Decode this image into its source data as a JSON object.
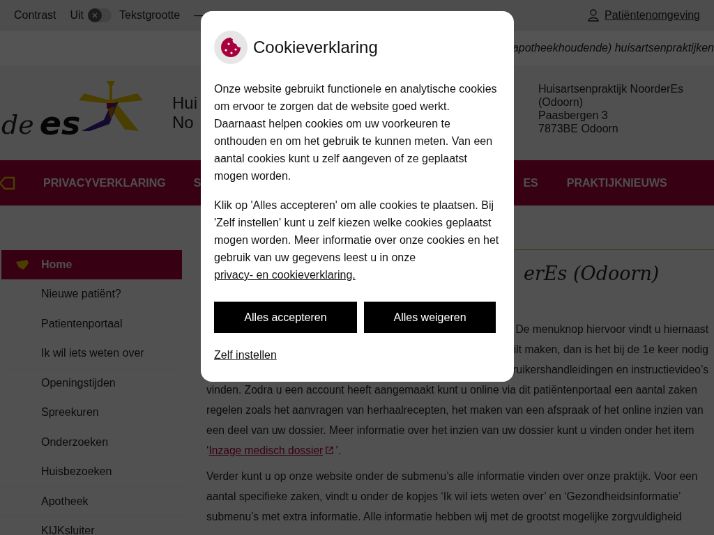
{
  "top_bar": {
    "contrast_label": "Contrast",
    "contrast_state": "Uit",
    "contrast_on": false,
    "text_size_label": "Tekstgrootte",
    "decrease": "—",
    "patient_link": "Patiëntenomgeving"
  },
  "tagline": "apotheekhoudende) huisartsenpraktijken",
  "logo": {
    "word_1": "de",
    "word_2": "es"
  },
  "practice_name": [
    "Hui",
    "No"
  ],
  "address": [
    "Huisartsenpraktijk NoorderEs",
    "(Odoorn)",
    "Paasbergen 3",
    "7873BE Odoorn"
  ],
  "nav": [
    {
      "label": "PRIVACYVERKLARING"
    },
    {
      "label": "S"
    },
    {
      "label": "ES"
    },
    {
      "label": "PRAKTIJKNIEUWS"
    }
  ],
  "sidebar": [
    {
      "label": "Home",
      "selected": true
    },
    {
      "label": "Nieuwe patiënt?",
      "selected": false
    },
    {
      "label": "Patientenportaal",
      "selected": false
    },
    {
      "label": "Ik wil iets weten over",
      "selected": false
    },
    {
      "label": "Openingstijden",
      "selected": false
    },
    {
      "label": "Spreekuren",
      "selected": false
    },
    {
      "label": "Onderzoeken",
      "selected": false
    },
    {
      "label": "Huisbezoeken",
      "selected": false
    },
    {
      "label": "Apotheek",
      "selected": false
    },
    {
      "label": "KIJKsluiter",
      "selected": false
    }
  ],
  "heading": "erEs (Odoorn)",
  "content_lines": [
    {
      "kind": "partial",
      "text": "De menuknop hiervoor vindt u hiernaast"
    },
    {
      "kind": "partial",
      "text": "ilt maken, dan is het bij de 1e keer nodig"
    },
    {
      "kind": "partial",
      "text": "ruikershandleidingen en instructievideo’s"
    },
    {
      "kind": "full",
      "text": "vinden. Zodra u een account heeft aangemaakt kunt u online via dit patiëntenportaal een aantal zaken"
    },
    {
      "kind": "full",
      "text": "regelen zoals het aanvragen van herhaalrecepten, het maken van een afspraak of het online inzien van"
    },
    {
      "kind": "full",
      "text": "een deel van uw dossier. Meer informatie over het inzien van uw dossier kunt u vinden onder het item"
    },
    {
      "kind": "link",
      "before": "‘",
      "link": "Inzage medisch dossier",
      "after": "’."
    },
    {
      "kind": "gap"
    },
    {
      "kind": "full",
      "text": "Verder kunt u op onze website onder de submenu’s alle informatie vinden over onze praktijk. Voor een"
    },
    {
      "kind": "full",
      "text": "aantal specifieke zaken, vindt u onder de kopjes ‘Ik wil iets weten over’ en ‘Gezondheidsinformatie’"
    },
    {
      "kind": "full",
      "text": "submenu’s met extra informatie. Alle informatie hebben wij met de grootst mogelijke zorgvuldigheid"
    }
  ],
  "cookie_dialog": {
    "title": "Cookieverklaring",
    "paragraph_1": "Onze website gebruikt functionele en analytische cookies om ervoor te zorgen dat de website goed werkt. Daarnaast helpen cookies om uw voorkeuren te onthouden en om het gebruik te kunnen meten. Van een aantal cookies kunt u zelf aangeven of ze geplaatst mogen worden.",
    "paragraph_2": "Klik op 'Alles accepteren' om alle cookies te plaatsen. Bij 'Zelf instellen' kunt u zelf kiezen welke cookies geplaatst mogen worden. Meer informatie over onze cookies en het gebruik van uw gegevens leest u in onze",
    "policy_link": "privacy- en cookieverklaring.",
    "accept_button": "Alles accepteren",
    "reject_button": "Alles weigeren",
    "settings_link": "Zelf instellen"
  }
}
